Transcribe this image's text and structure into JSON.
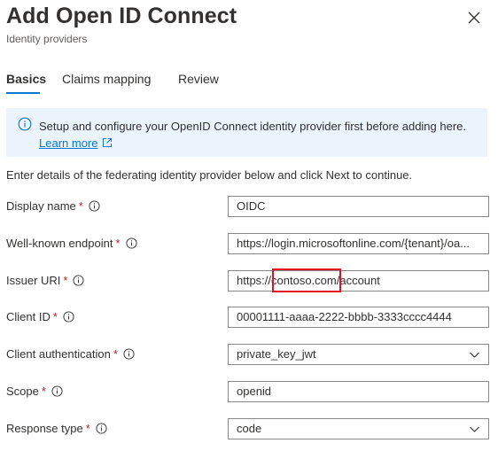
{
  "header": {
    "title": "Add Open ID Connect",
    "subtitle": "Identity providers"
  },
  "tabs": [
    {
      "label": "Basics",
      "active": true
    },
    {
      "label": "Claims mapping",
      "active": false
    },
    {
      "label": "Review",
      "active": false
    }
  ],
  "banner": {
    "text": "Setup and configure your OpenID Connect identity provider first before adding here. ",
    "link_label": "Learn more"
  },
  "intro": "Enter details of the federating identity provider below and click Next to continue.",
  "fields": {
    "display_name": {
      "label": "Display name",
      "value": "OIDC"
    },
    "well_known_endpoint": {
      "label": "Well-known endpoint",
      "value": "https://login.microsoftonline.com/{tenant}/oa..."
    },
    "issuer_uri": {
      "label": "Issuer URI",
      "value": "https://contoso.com/account"
    },
    "client_id": {
      "label": "Client ID",
      "value": "00001111-aaaa-2222-bbbb-3333cccc4444"
    },
    "client_authentication": {
      "label": "Client authentication",
      "value": "private_key_jwt"
    },
    "scope": {
      "label": "Scope",
      "value": "openid"
    },
    "response_type": {
      "label": "Response type",
      "value": "code"
    }
  },
  "required_marker": "*",
  "colors": {
    "accent": "#0078d4",
    "banner_bg": "#ebf3fc",
    "required": "#a4262c",
    "highlight": "#e81123"
  },
  "icons": [
    "close-icon",
    "info-icon",
    "external-link-icon",
    "help-info-icon",
    "chevron-down-icon"
  ]
}
